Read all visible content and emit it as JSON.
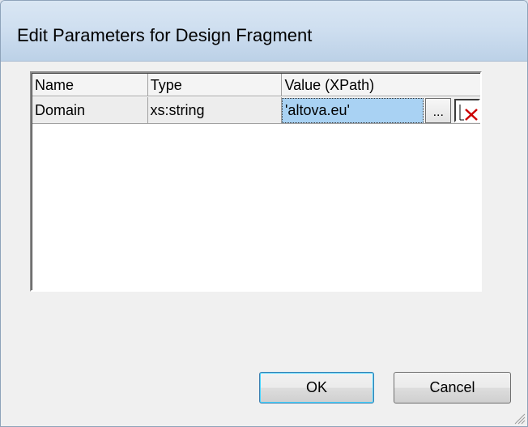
{
  "window": {
    "title": "Edit Parameters for Design Fragment"
  },
  "table": {
    "headers": [
      "Name",
      "Type",
      "Value (XPath)"
    ],
    "rows": [
      {
        "name": "Domain",
        "type": "xs:string",
        "value": "'altova.eu'"
      }
    ]
  },
  "buttons": {
    "ellipsis": "...",
    "ok": "OK",
    "cancel": "Cancel"
  },
  "colors": {
    "selected_value_bg": "#a9d2f3",
    "delete_icon": "#cc0000"
  },
  "icons": {
    "delete": "delete-x-icon",
    "grip": "resize-grip-icon"
  }
}
